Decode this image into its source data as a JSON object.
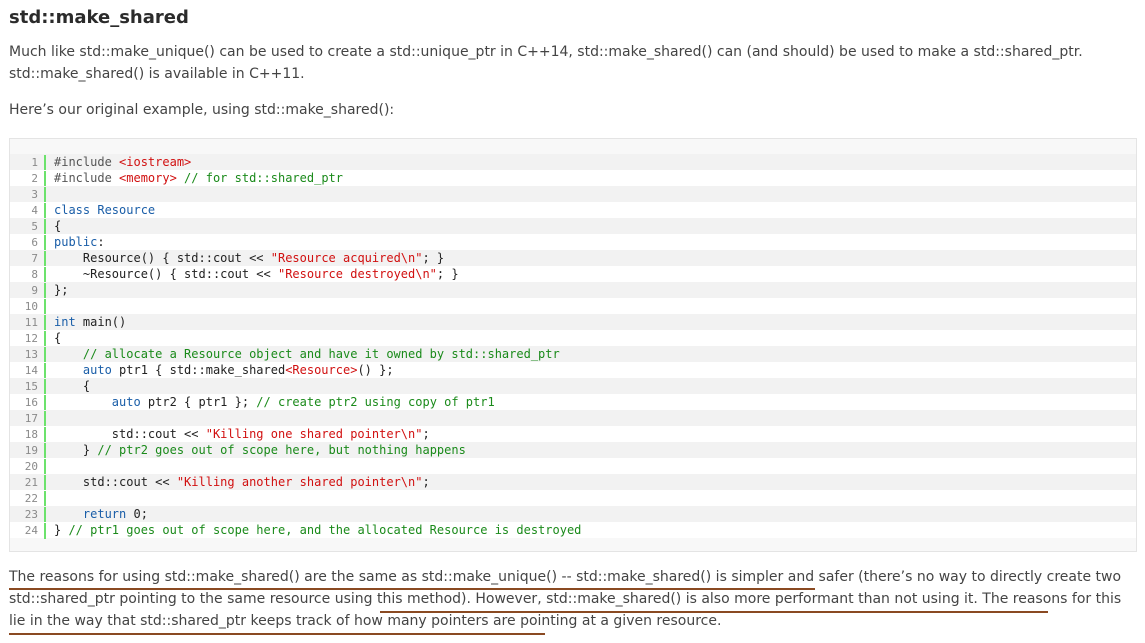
{
  "heading": "std::make_shared",
  "intro": "Much like std::make_unique() can be used to create a std::unique_ptr in C++14, std::make_shared() can (and should) be used to make a std::shared_ptr. std::make_shared() is available in C++11.",
  "lead": "Here’s our original example, using std::make_shared():",
  "code": [
    {
      "n": "1",
      "tokens": [
        [
          "pre",
          "#include "
        ],
        [
          "str",
          "<iostream>"
        ]
      ]
    },
    {
      "n": "2",
      "tokens": [
        [
          "pre",
          "#include "
        ],
        [
          "str",
          "<memory>"
        ],
        [
          "cmt",
          " // for std::shared_ptr"
        ]
      ]
    },
    {
      "n": "3",
      "tokens": []
    },
    {
      "n": "4",
      "tokens": [
        [
          "kw",
          "class Resource"
        ]
      ]
    },
    {
      "n": "5",
      "tokens": [
        [
          "plain",
          "{"
        ]
      ]
    },
    {
      "n": "6",
      "tokens": [
        [
          "kw",
          "public"
        ],
        [
          "plain",
          ":"
        ]
      ]
    },
    {
      "n": "7",
      "tokens": [
        [
          "plain",
          "    Resource() { std::cout << "
        ],
        [
          "str",
          "\"Resource acquired\\n\""
        ],
        [
          "plain",
          "; }"
        ]
      ]
    },
    {
      "n": "8",
      "tokens": [
        [
          "plain",
          "    ~Resource() { std::cout << "
        ],
        [
          "str",
          "\"Resource destroyed\\n\""
        ],
        [
          "plain",
          "; }"
        ]
      ]
    },
    {
      "n": "9",
      "tokens": [
        [
          "plain",
          "};"
        ]
      ]
    },
    {
      "n": "10",
      "tokens": []
    },
    {
      "n": "11",
      "tokens": [
        [
          "kw",
          "int"
        ],
        [
          "plain",
          " main()"
        ]
      ]
    },
    {
      "n": "12",
      "tokens": [
        [
          "plain",
          "{"
        ]
      ]
    },
    {
      "n": "13",
      "tokens": [
        [
          "cmt",
          "    // allocate a Resource object and have it owned by std::shared_ptr"
        ]
      ]
    },
    {
      "n": "14",
      "tokens": [
        [
          "kw",
          "    auto"
        ],
        [
          "plain",
          " ptr1 { std::make_shared"
        ],
        [
          "str",
          "<Resource>"
        ],
        [
          "plain",
          "() };"
        ]
      ]
    },
    {
      "n": "15",
      "tokens": [
        [
          "plain",
          "    {"
        ]
      ]
    },
    {
      "n": "16",
      "tokens": [
        [
          "kw",
          "        auto"
        ],
        [
          "plain",
          " ptr2 { ptr1 }; "
        ],
        [
          "cmt",
          "// create ptr2 using copy of ptr1"
        ]
      ]
    },
    {
      "n": "17",
      "tokens": []
    },
    {
      "n": "18",
      "tokens": [
        [
          "plain",
          "        std::cout << "
        ],
        [
          "str",
          "\"Killing one shared pointer\\n\""
        ],
        [
          "plain",
          ";"
        ]
      ]
    },
    {
      "n": "19",
      "tokens": [
        [
          "plain",
          "    } "
        ],
        [
          "cmt",
          "// ptr2 goes out of scope here, but nothing happens"
        ]
      ]
    },
    {
      "n": "20",
      "tokens": []
    },
    {
      "n": "21",
      "tokens": [
        [
          "plain",
          "    std::cout << "
        ],
        [
          "str",
          "\"Killing another shared pointer\\n\""
        ],
        [
          "plain",
          ";"
        ]
      ]
    },
    {
      "n": "22",
      "tokens": []
    },
    {
      "n": "23",
      "tokens": [
        [
          "kw",
          "    return"
        ],
        [
          "plain",
          " 0;"
        ]
      ]
    },
    {
      "n": "24",
      "tokens": [
        [
          "plain",
          "} "
        ],
        [
          "cmt",
          "// ptr1 goes out of scope here, and the allocated Resource is destroyed"
        ]
      ]
    }
  ],
  "closing": "The reasons for using std::make_shared() are the same as std::make_unique() -- std::make_shared() is simpler and safer (there’s no way to directly create two std::shared_ptr pointing to the same resource using this method). However, std::make_shared() is also more performant than not using it. The reasons for this lie in the way that std::shared_ptr keeps track of how many pointers are pointing at a given resource.",
  "colors": {
    "underline": "#8a4a22",
    "keyword": "#1a5ea8",
    "string": "#d11010",
    "comment": "#1a8a1a",
    "gutter_border": "#6ce26c"
  }
}
